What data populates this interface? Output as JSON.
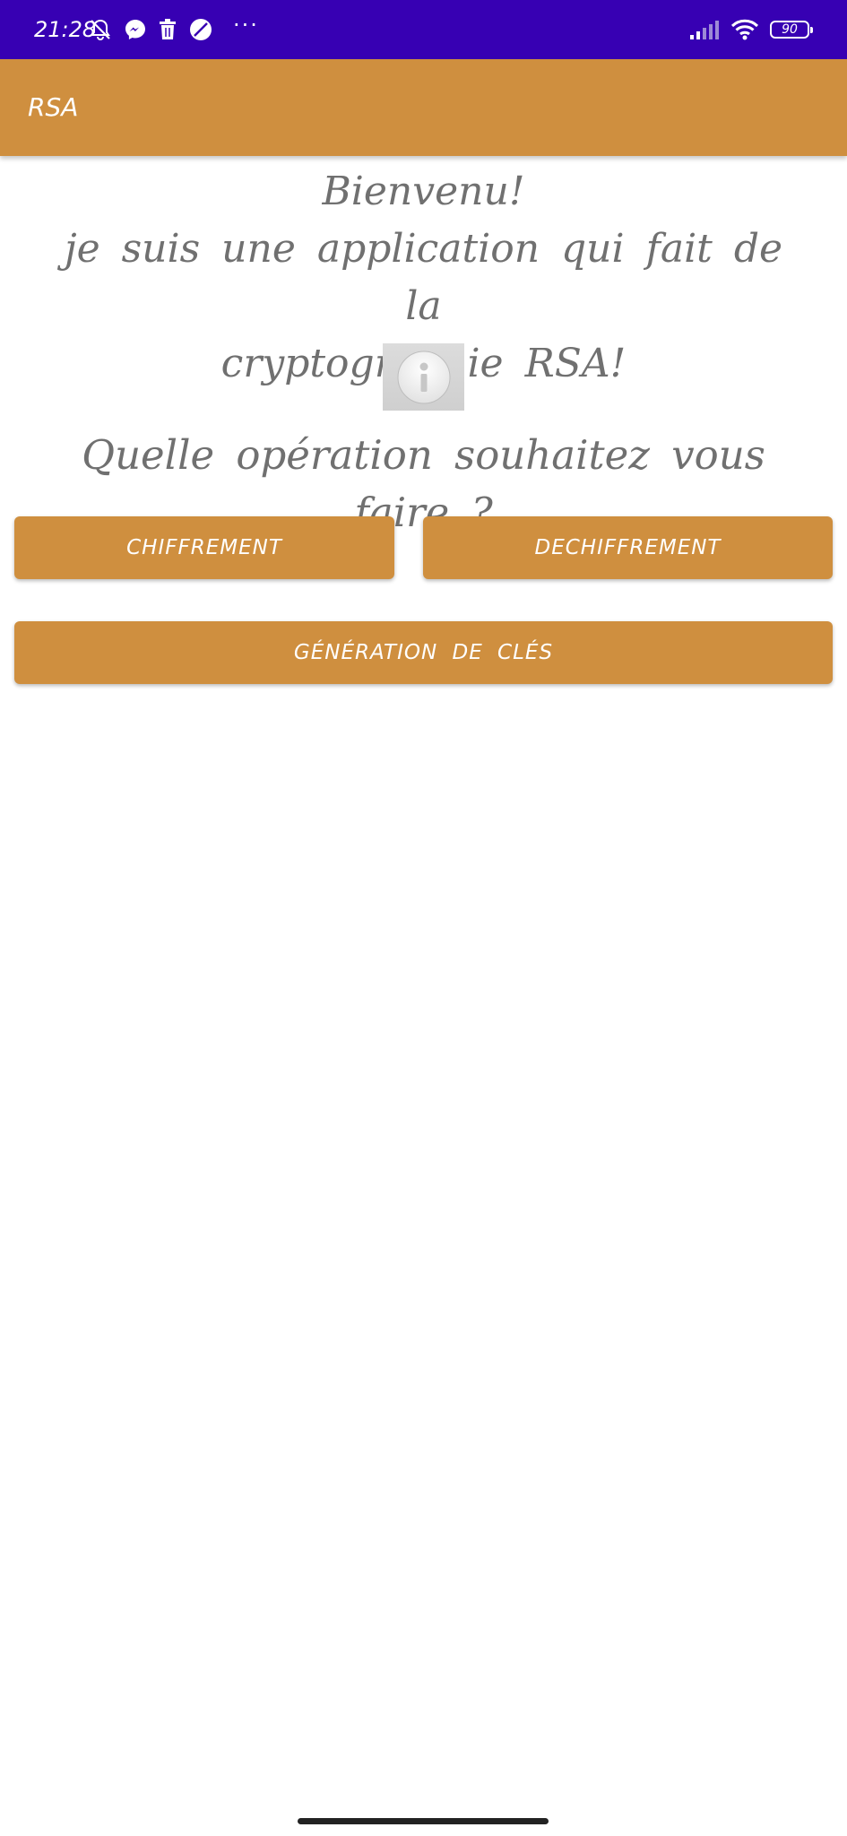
{
  "status_bar": {
    "time": "21:28",
    "left_icons": [
      "muted-bell-icon",
      "messenger-icon",
      "trash-icon",
      "no-sign-icon"
    ],
    "more_indicator": "···",
    "right_icons": [
      "signal-icon",
      "wifi-icon"
    ],
    "battery": "90",
    "background": "#3700b3"
  },
  "app_bar": {
    "title": "RSA",
    "background": "#cf8f3f"
  },
  "welcome": {
    "line1": "Bienvenu!",
    "line2": "je suis une application qui fait de la",
    "line3": "cryptographie RSA!"
  },
  "info_image": {
    "icon": "info-icon"
  },
  "question": "Quelle opération souhaitez vous faire ?",
  "buttons": {
    "encrypt": "CHIFFREMENT",
    "decrypt": "DECHIFFREMENT",
    "keygen": "GÉNÉRATION DE CLÉS"
  },
  "colors": {
    "accent": "#cf8f3f",
    "text": "#707070",
    "button_text": "#ffffff"
  }
}
